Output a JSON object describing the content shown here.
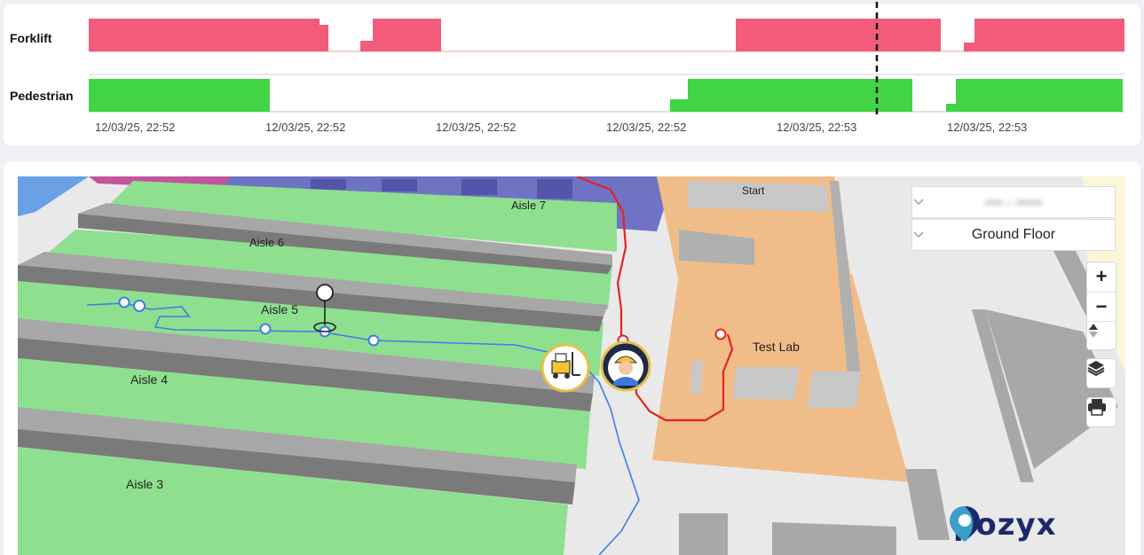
{
  "timeline": {
    "rows": [
      {
        "label": "Forklift",
        "color": "#f25c7a"
      },
      {
        "label": "Pedestrian",
        "color": "#41d444"
      }
    ],
    "ticks": [
      "12/03/25, 22:52",
      "12/03/25, 22:52",
      "12/03/25, 22:52",
      "12/03/25, 22:52",
      "12/03/25, 22:53",
      "12/03/25, 22:53"
    ]
  },
  "map": {
    "zone_select": {
      "value": "•••• – ••••••"
    },
    "floor_select": {
      "value": "Ground Floor"
    },
    "labels": {
      "aisle7": "Aisle 7",
      "aisle6": "Aisle 6",
      "aisle5": "Aisle 5",
      "aisle4": "Aisle 4",
      "aisle3": "Aisle 3",
      "start": "Start",
      "test_lab": "Test Lab"
    },
    "controls": {
      "zoom_in": "+",
      "zoom_out": "−"
    },
    "colors": {
      "forklift_track": "#3f7de8",
      "pedestrian_track": "#e52222",
      "aisle_green": "#8ee08f",
      "shelf_gray": "#8c8c8c",
      "room_orange": "#f0bd89"
    },
    "icons": {
      "forklift": "forklift-marker-icon",
      "pedestrian": "worker-marker-icon",
      "layers": "layers-icon",
      "print": "print-icon",
      "compass": "compass-icon"
    },
    "brand": "pozyx"
  }
}
